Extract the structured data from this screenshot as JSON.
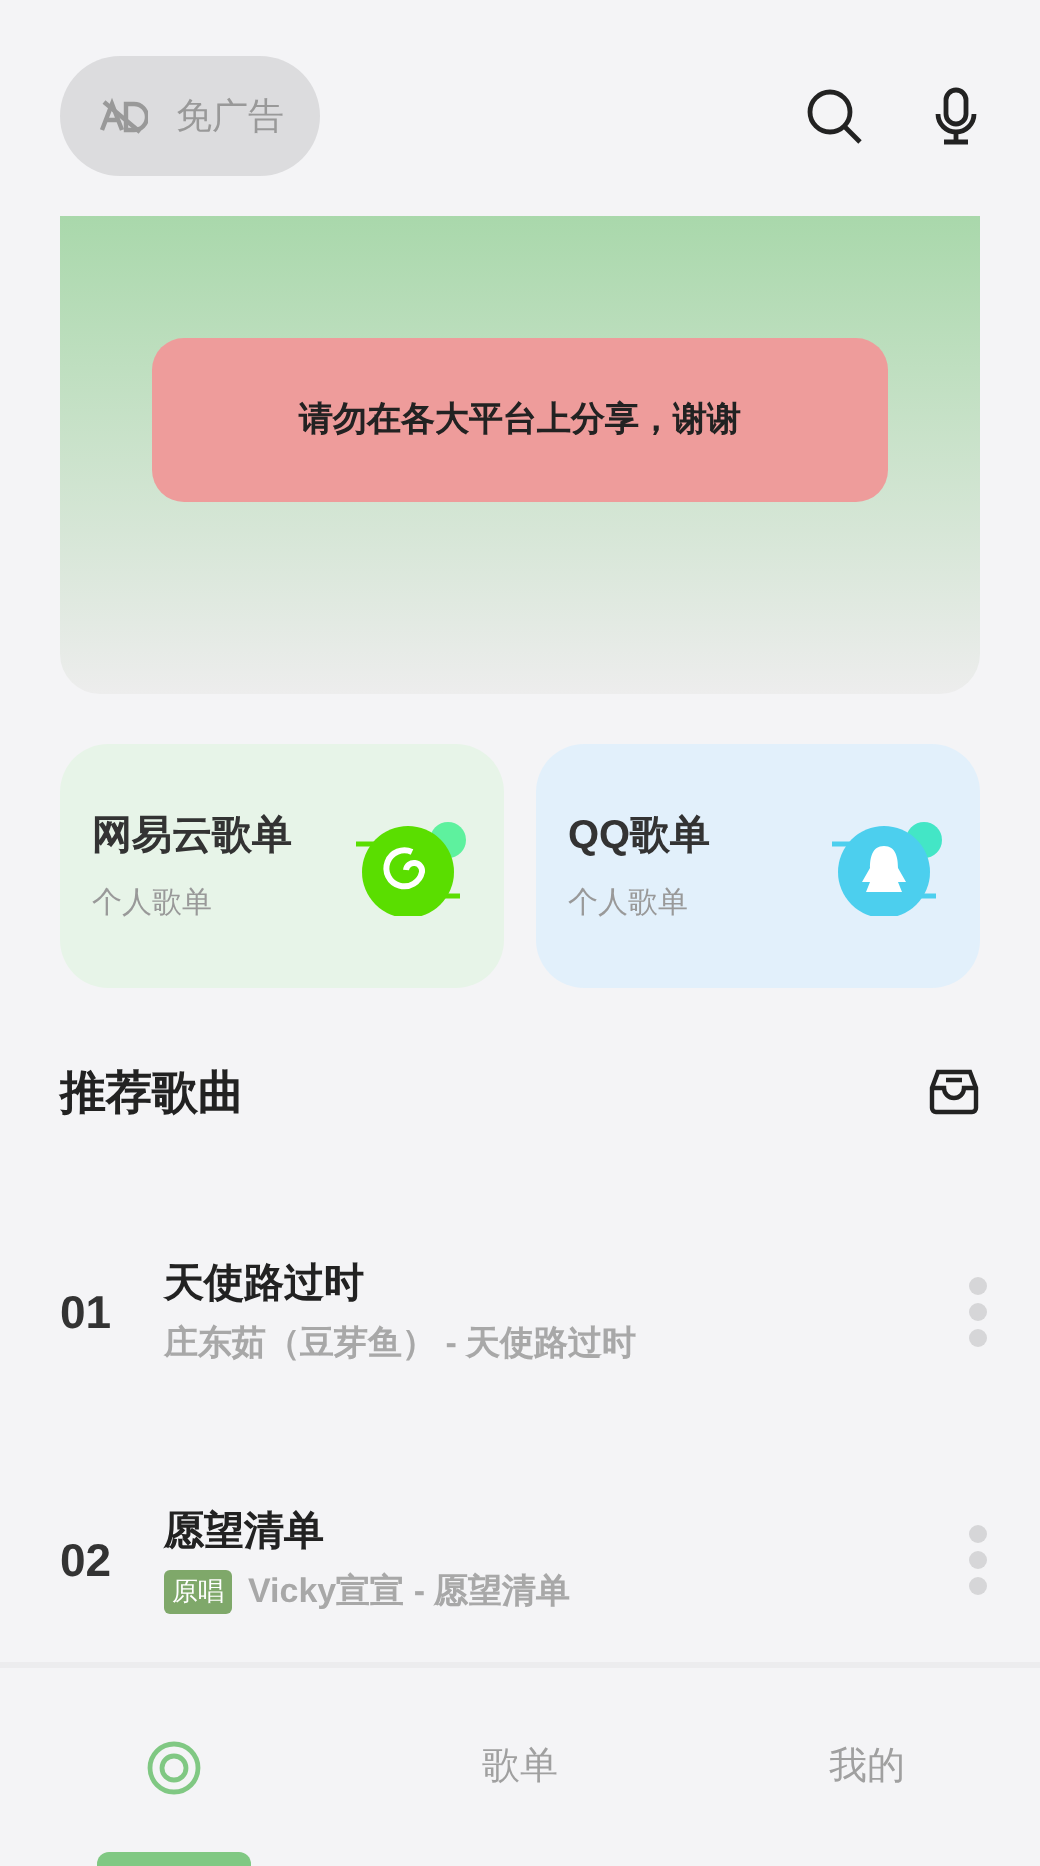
{
  "ad_free_button": {
    "label": "免广告"
  },
  "banner": {
    "notice": "请勿在各大平台上分享，谢谢"
  },
  "playlist_cards": [
    {
      "kind": "netease",
      "title": "网易云歌单",
      "subtitle": "个人歌单"
    },
    {
      "kind": "qq",
      "title": "QQ歌单",
      "subtitle": "个人歌单"
    }
  ],
  "section": {
    "title": "推荐歌曲"
  },
  "songs": [
    {
      "number": "01",
      "title": "天使路过时",
      "subtitle": "庄东茹（豆芽鱼） - 天使路过时"
    },
    {
      "number": "02",
      "title": "愿望清单",
      "tag": "原唱",
      "subtitle": "Vicky宣宣 - 愿望清单"
    }
  ],
  "bottom_tabs": [
    {
      "kind": "icon",
      "selected": true
    },
    {
      "kind": "text",
      "label": "歌单",
      "selected": false
    },
    {
      "kind": "text",
      "label": "我的",
      "selected": false
    }
  ]
}
